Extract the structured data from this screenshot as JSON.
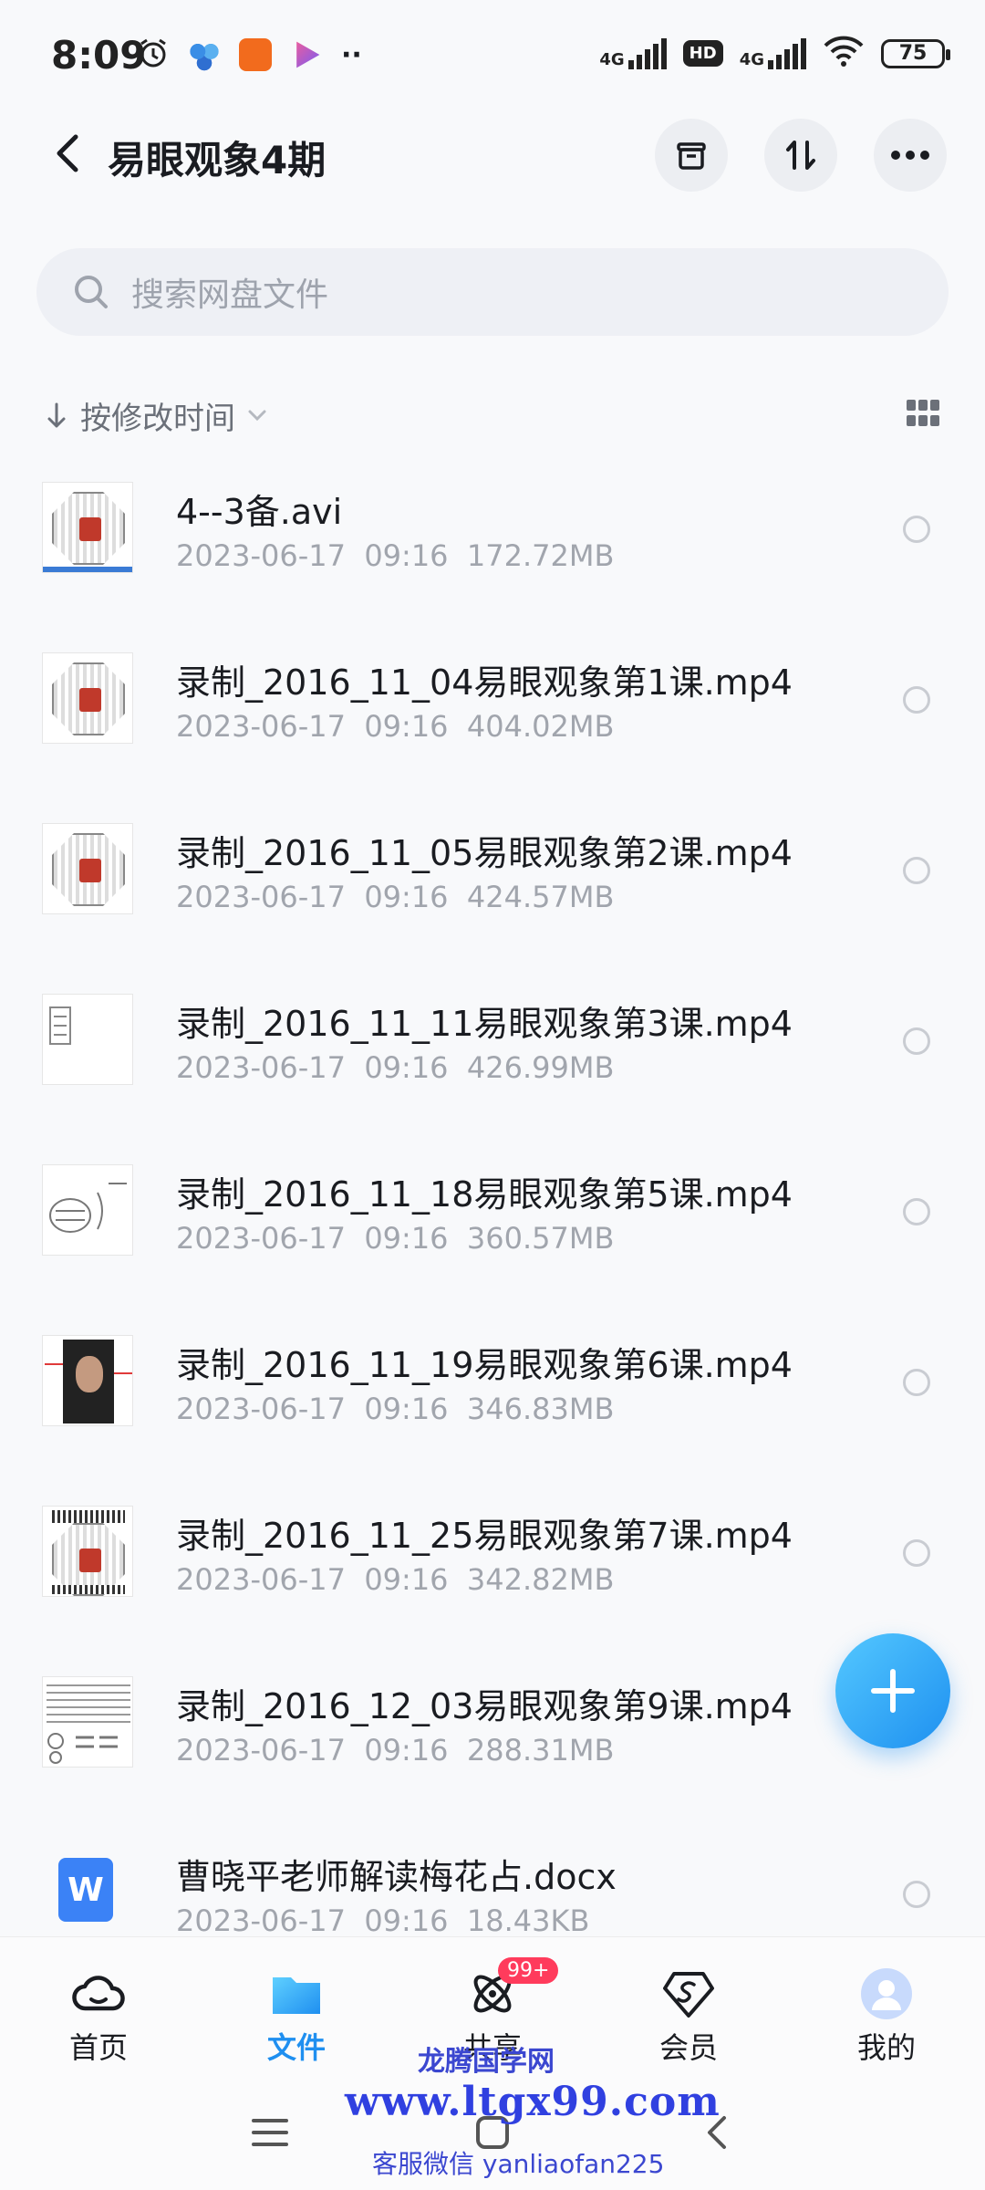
{
  "status_bar": {
    "time": "8:09",
    "network1": "4G",
    "hd": "HD",
    "network2": "4G",
    "battery": "75"
  },
  "header": {
    "title": "易眼观象4期",
    "icons": [
      "back-arrow-icon",
      "archive-icon",
      "sort-swap-icon",
      "more-icon"
    ]
  },
  "search": {
    "placeholder": "搜索网盘文件"
  },
  "sort": {
    "label": "按修改时间"
  },
  "files": [
    {
      "name": "4--3备.avi",
      "date": "2023-06-17",
      "time": "09:16",
      "size": "172.72MB"
    },
    {
      "name": "录制_2016_11_04易眼观象第1课.mp4",
      "date": "2023-06-17",
      "time": "09:16",
      "size": "404.02MB"
    },
    {
      "name": "录制_2016_11_05易眼观象第2课.mp4",
      "date": "2023-06-17",
      "time": "09:16",
      "size": "424.57MB"
    },
    {
      "name": "录制_2016_11_11易眼观象第3课.mp4",
      "date": "2023-06-17",
      "time": "09:16",
      "size": "426.99MB"
    },
    {
      "name": "录制_2016_11_18易眼观象第5课.mp4",
      "date": "2023-06-17",
      "time": "09:16",
      "size": "360.57MB"
    },
    {
      "name": "录制_2016_11_19易眼观象第6课.mp4",
      "date": "2023-06-17",
      "time": "09:16",
      "size": "346.83MB"
    },
    {
      "name": "录制_2016_11_25易眼观象第7课.mp4",
      "date": "2023-06-17",
      "time": "09:16",
      "size": "342.82MB"
    },
    {
      "name": "录制_2016_12_03易眼观象第9课.mp4",
      "date": "2023-06-17",
      "time": "09:16",
      "size": "288.31MB"
    },
    {
      "name": "曹晓平老师解读梅花占.docx",
      "date": "2023-06-17",
      "time": "09:16",
      "size": "18.43KB"
    }
  ],
  "bottom_nav": {
    "items": [
      {
        "label": "首页",
        "icon": "cloud-icon"
      },
      {
        "label": "文件",
        "icon": "folder-icon"
      },
      {
        "label": "共享",
        "icon": "atom-icon",
        "badge": "99+"
      },
      {
        "label": "会员",
        "icon": "vip-s-icon"
      },
      {
        "label": "我的",
        "icon": "avatar-icon"
      }
    ]
  },
  "watermark": {
    "line1": "龙腾国学网",
    "line2": "www.ltgx99.com",
    "line3": "客服微信 yanliaofan225"
  },
  "colors": {
    "accent": "#1f8ff0",
    "badge": "#ff3b5c"
  }
}
